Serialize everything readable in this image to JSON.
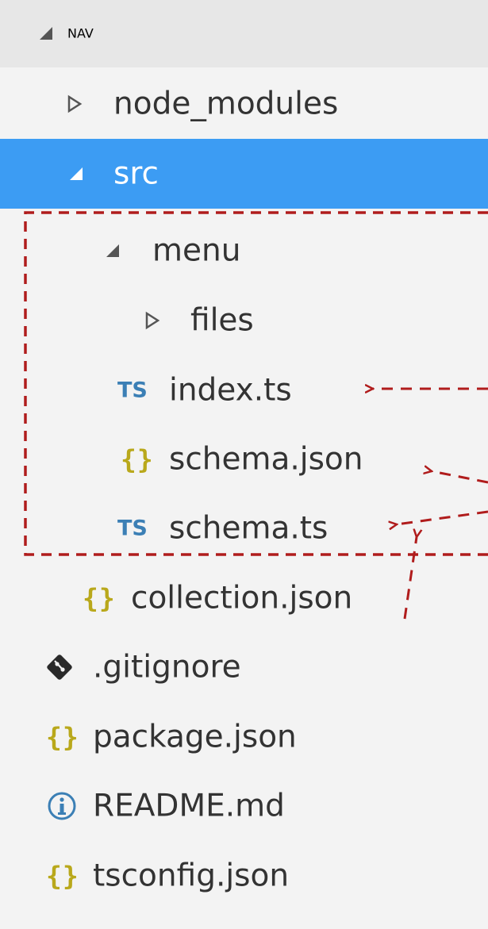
{
  "explorer": {
    "section_title": "NAV",
    "items": [
      {
        "label": "node_modules",
        "kind": "folder",
        "expanded": false,
        "depth": 1,
        "icon": "chevron-right-icon"
      },
      {
        "label": "src",
        "kind": "folder",
        "expanded": true,
        "depth": 1,
        "selected": true,
        "icon": "chevron-down-icon"
      },
      {
        "label": "menu",
        "kind": "folder",
        "expanded": true,
        "depth": 2,
        "icon": "chevron-down-icon"
      },
      {
        "label": "files",
        "kind": "folder",
        "expanded": false,
        "depth": 3,
        "icon": "chevron-right-icon"
      },
      {
        "label": "index.ts",
        "kind": "file",
        "icon_text": "TS",
        "icon": "typescript-icon",
        "depth": 3
      },
      {
        "label": "schema.json",
        "kind": "file",
        "icon_text": "{}",
        "icon": "json-icon",
        "depth": 3
      },
      {
        "label": "schema.ts",
        "kind": "file",
        "icon_text": "TS",
        "icon": "typescript-icon",
        "depth": 3
      },
      {
        "label": "collection.json",
        "kind": "file",
        "icon_text": "{}",
        "icon": "json-icon",
        "depth": 2
      },
      {
        "label": ".gitignore",
        "kind": "file",
        "icon": "git-icon",
        "depth": 1
      },
      {
        "label": "package.json",
        "kind": "file",
        "icon_text": "{}",
        "icon": "json-icon",
        "depth": 1
      },
      {
        "label": "README.md",
        "kind": "file",
        "icon": "info-icon",
        "depth": 1
      },
      {
        "label": "tsconfig.json",
        "kind": "file",
        "icon_text": "{}",
        "icon": "json-icon",
        "depth": 1
      }
    ]
  },
  "colors": {
    "selection": "#3c9cf3",
    "background": "#f3f3f3",
    "header_background": "#e7e7e7",
    "typescript": "#3b7fb5",
    "json": "#b9a81b",
    "annotation": "#b01c1c"
  }
}
